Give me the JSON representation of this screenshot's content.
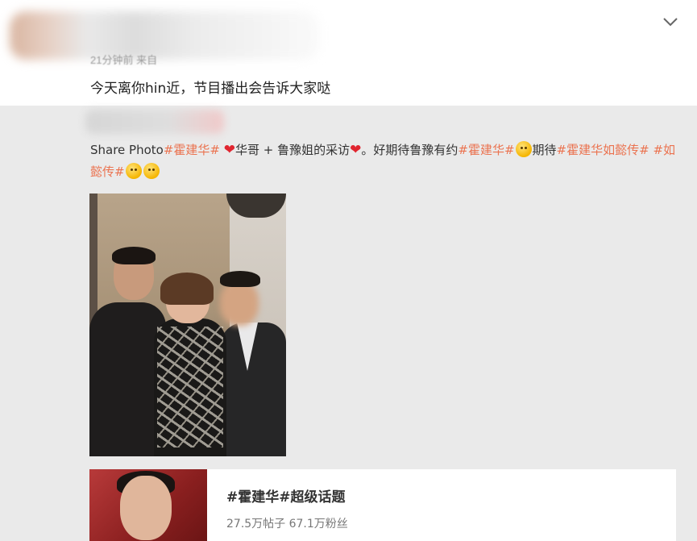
{
  "post": {
    "meta": "21分钟前 来自",
    "text": "今天离你hin近，节目播出会告诉大家哒"
  },
  "repost": {
    "segments": [
      {
        "type": "text",
        "value": "Share Photo"
      },
      {
        "type": "tag",
        "value": "#霍建华#"
      },
      {
        "type": "text",
        "value": " "
      },
      {
        "type": "heart",
        "value": "❤"
      },
      {
        "type": "text",
        "value": "华哥 + 鲁豫姐的采访"
      },
      {
        "type": "heart",
        "value": "❤"
      },
      {
        "type": "text",
        "value": "。好期待鲁豫有约"
      },
      {
        "type": "tag",
        "value": "#霍建华#"
      },
      {
        "type": "emoji",
        "value": "doge-emoji"
      },
      {
        "type": "text",
        "value": "期待"
      },
      {
        "type": "tag",
        "value": "#霍建华如懿传#"
      },
      {
        "type": "text",
        "value": " "
      },
      {
        "type": "tag",
        "value": "#如懿传#"
      },
      {
        "type": "emoji",
        "value": "doge-emoji"
      },
      {
        "type": "emoji",
        "value": "doge-emoji"
      }
    ]
  },
  "topic_card": {
    "title": "#霍建华#超级话题",
    "stats": "27.5万帖子 67.1万粉丝"
  },
  "colors": {
    "tag": "#eb7350",
    "heart": "#e0252f",
    "repost_bg": "#eaeaea"
  },
  "icons": {
    "collapse": "chevron-down-icon"
  }
}
